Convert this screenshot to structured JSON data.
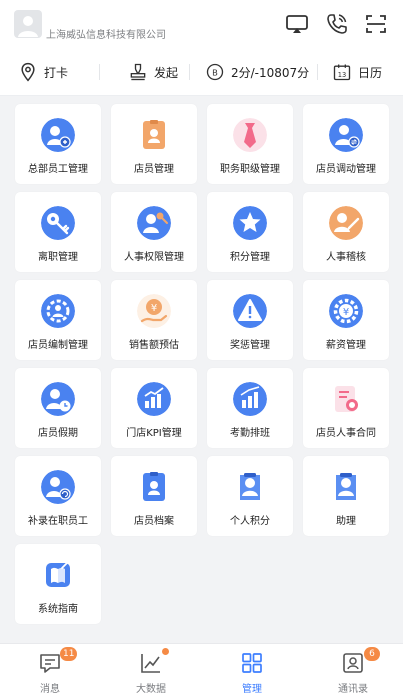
{
  "header": {
    "company_name": "上海威弘信息科技有限公司",
    "icons": [
      "avatar-placeholder",
      "screen-cast-icon",
      "phone-call-icon",
      "scan-icon"
    ]
  },
  "quick_actions": [
    {
      "label": "打卡",
      "icon": "location-pin-icon"
    },
    {
      "label": "发起",
      "icon": "stamp-icon"
    },
    {
      "label": "2分/-10807分",
      "icon": "points-coin-icon"
    },
    {
      "label": "日历",
      "icon": "calendar-icon",
      "calendar_day": "13"
    }
  ],
  "modules": [
    {
      "label": "总部员工管理",
      "icon": "staff-group-icon"
    },
    {
      "label": "店员管理",
      "icon": "id-badge-icon"
    },
    {
      "label": "职务职级管理",
      "icon": "tie-icon"
    },
    {
      "label": "店员调动管理",
      "icon": "transfer-user-icon"
    },
    {
      "label": "离职管理",
      "icon": "key-icon"
    },
    {
      "label": "人事权限管理",
      "icon": "permission-key-icon"
    },
    {
      "label": "积分管理",
      "icon": "star-icon"
    },
    {
      "label": "人事稽核",
      "icon": "audit-icon"
    },
    {
      "label": "店员编制管理",
      "icon": "org-gear-icon"
    },
    {
      "label": "销售额预估",
      "icon": "sales-money-icon"
    },
    {
      "label": "奖惩管理",
      "icon": "warning-icon"
    },
    {
      "label": "薪资管理",
      "icon": "salary-gear-icon"
    },
    {
      "label": "店员假期",
      "icon": "vacation-clock-icon"
    },
    {
      "label": "门店KPI管理",
      "icon": "kpi-chart-icon"
    },
    {
      "label": "考勤排班",
      "icon": "schedule-chart-icon"
    },
    {
      "label": "店员人事合同",
      "icon": "contract-icon"
    },
    {
      "label": "补录在职员工",
      "icon": "supplement-user-icon"
    },
    {
      "label": "店员档案",
      "icon": "profile-card-icon"
    },
    {
      "label": "个人积分",
      "icon": "person-points-icon"
    },
    {
      "label": "助理",
      "icon": "assistant-icon"
    },
    {
      "label": "系统指南",
      "icon": "guide-icon"
    }
  ],
  "tabbar": [
    {
      "label": "消息",
      "icon": "message-icon",
      "badge": "11"
    },
    {
      "label": "大数据",
      "icon": "trend-chart-icon",
      "dot": true
    },
    {
      "label": "管理",
      "icon": "grid-apps-icon",
      "active": true
    },
    {
      "label": "通讯录",
      "icon": "contacts-icon",
      "badge": "6"
    }
  ],
  "colors": {
    "accent": "#3d7eff",
    "badge": "#f58a45",
    "blue_icon": "#4a82f0",
    "orange_icon": "#f2a66a",
    "pink_icon": "#f26a8a"
  }
}
